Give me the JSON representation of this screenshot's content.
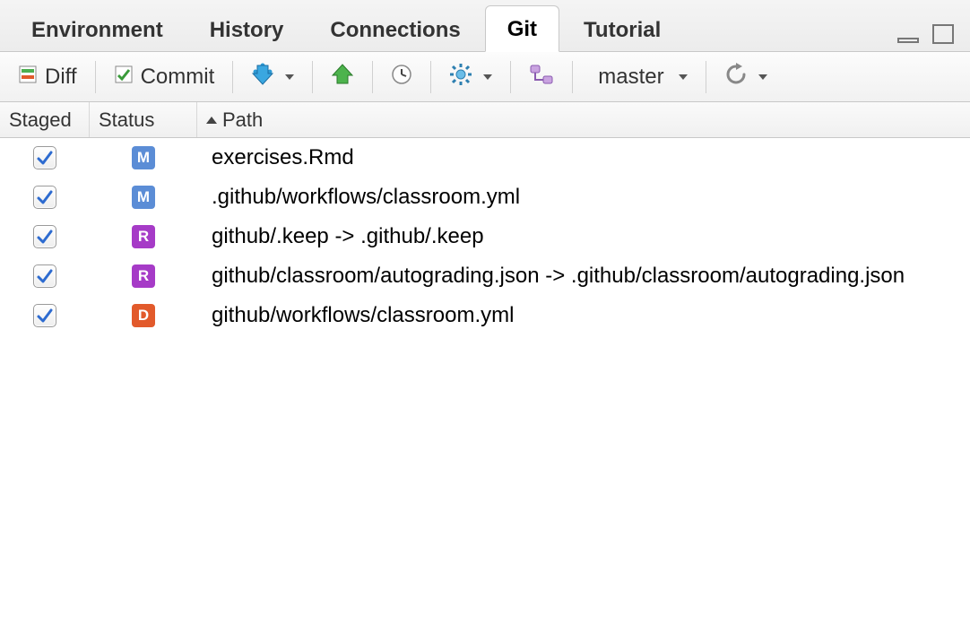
{
  "tabs": {
    "items": [
      {
        "label": "Environment",
        "active": false
      },
      {
        "label": "History",
        "active": false
      },
      {
        "label": "Connections",
        "active": false
      },
      {
        "label": "Git",
        "active": true
      },
      {
        "label": "Tutorial",
        "active": false
      }
    ]
  },
  "toolbar": {
    "diff_label": "Diff",
    "commit_label": "Commit",
    "branch_label": "master"
  },
  "columns": {
    "staged": "Staged",
    "status": "Status",
    "path": "Path"
  },
  "rows": [
    {
      "staged": true,
      "status": "M",
      "path": "exercises.Rmd"
    },
    {
      "staged": true,
      "status": "M",
      "path": ".github/workflows/classroom.yml"
    },
    {
      "staged": true,
      "status": "R",
      "path": "github/.keep -> .github/.keep"
    },
    {
      "staged": true,
      "status": "R",
      "path": "github/classroom/autograding.json -> .github/classroom/autograding.json"
    },
    {
      "staged": true,
      "status": "D",
      "path": "github/workflows/classroom.yml"
    }
  ],
  "status_colors": {
    "M": "#5b8dd6",
    "R": "#a63bc7",
    "D": "#e25a2b"
  }
}
